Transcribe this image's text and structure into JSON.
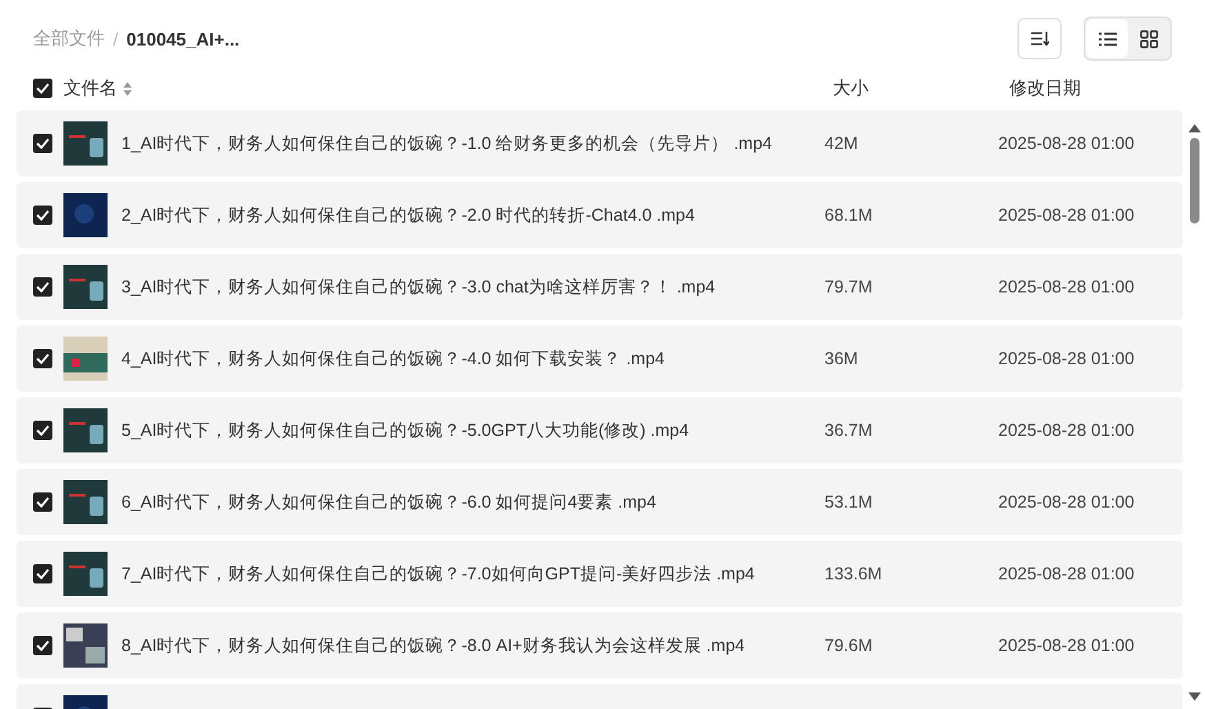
{
  "breadcrumb": {
    "separator": "/",
    "items": [
      {
        "label": "全部文件",
        "current": false
      },
      {
        "label": "010045_AI+...",
        "current": true
      }
    ]
  },
  "toolbar": {
    "views": [
      {
        "kind": "list",
        "selected": true
      },
      {
        "kind": "grid",
        "selected": false
      }
    ]
  },
  "table": {
    "all_checked": true,
    "columns": [
      "文件名",
      "大小",
      "修改日期"
    ],
    "rows": [
      {
        "checked": true,
        "kind": "slide",
        "name": "1_AI时代下，财务人如何保住自己的饭碗？-1.0 给财务更多的机会（先导片） .mp4",
        "size": "42M",
        "date": "2025-08-28 01:00"
      },
      {
        "checked": true,
        "kind": "blue",
        "name": "2_AI时代下，财务人如何保住自己的饭碗？-2.0 时代的转折-Chat4.0 .mp4",
        "size": "68.1M",
        "date": "2025-08-28 01:00"
      },
      {
        "checked": true,
        "kind": "slide",
        "name": "3_AI时代下，财务人如何保住自己的饭碗？-3.0 chat为啥这样厉害？！ .mp4",
        "size": "79.7M",
        "date": "2025-08-28 01:00"
      },
      {
        "checked": true,
        "kind": "screen",
        "name": "4_AI时代下，财务人如何保住自己的饭碗？-4.0 如何下载安装？ .mp4",
        "size": "36M",
        "date": "2025-08-28 01:00"
      },
      {
        "checked": true,
        "kind": "slide",
        "name": "5_AI时代下，财务人如何保住自己的饭碗？-5.0GPT八大功能(修改) .mp4",
        "size": "36.7M",
        "date": "2025-08-28 01:00"
      },
      {
        "checked": true,
        "kind": "slide",
        "name": "6_AI时代下，财务人如何保住自己的饭碗？-6.0 如何提问4要素 .mp4",
        "size": "53.1M",
        "date": "2025-08-28 01:00"
      },
      {
        "checked": true,
        "kind": "slide",
        "name": "7_AI时代下，财务人如何保住自己的饭碗？-7.0如何向GPT提问-美好四步法 .mp4",
        "size": "133.6M",
        "date": "2025-08-28 01:00"
      },
      {
        "checked": true,
        "kind": "photo",
        "name": "8_AI时代下，财务人如何保住自己的饭碗？-8.0 AI+财务我认为会这样发展 .mp4",
        "size": "79.6M",
        "date": "2025-08-28 01:00"
      },
      {
        "checked": true,
        "kind": "blue"
      }
    ]
  }
}
